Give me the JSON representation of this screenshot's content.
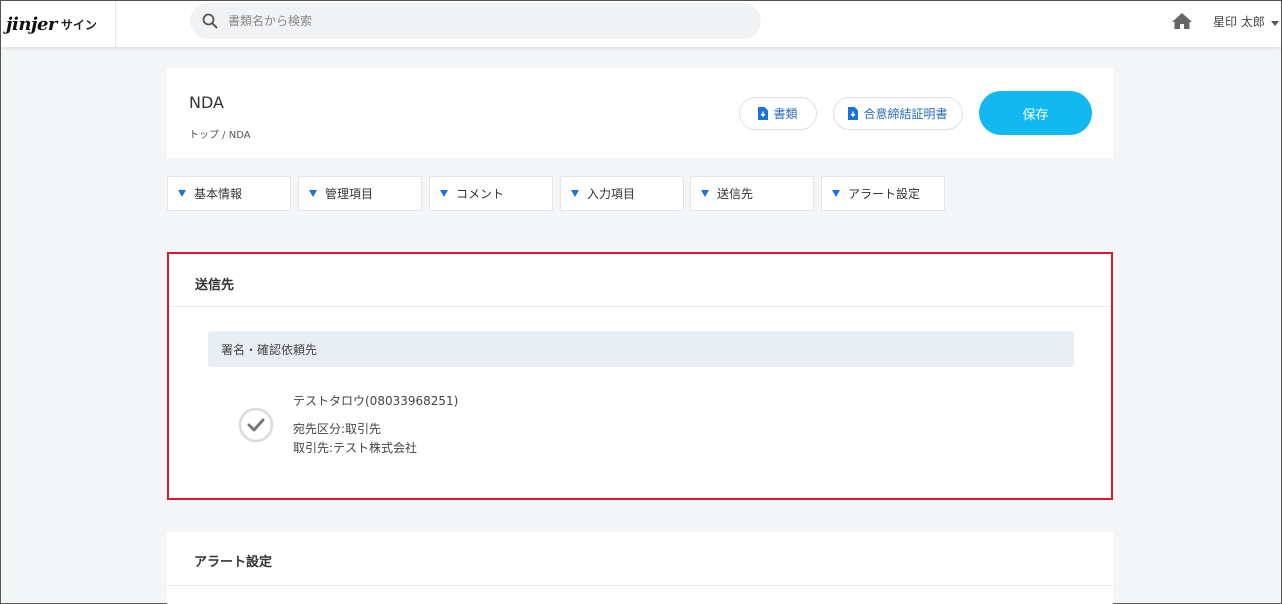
{
  "app": {
    "logo_text": "jinjer",
    "logo_sub": "サイン"
  },
  "search": {
    "placeholder": "書類名から検索"
  },
  "user": {
    "name": "星印 太郎"
  },
  "document": {
    "title": "NDA",
    "breadcrumb": "トップ / NDA"
  },
  "actions": {
    "docs_label": "書類",
    "certificate_label": "合意締結証明書",
    "save_label": "保存"
  },
  "tabs": [
    {
      "label": "基本情報"
    },
    {
      "label": "管理項目"
    },
    {
      "label": "コメント"
    },
    {
      "label": "入力項目"
    },
    {
      "label": "送信先"
    },
    {
      "label": "アラート設定"
    }
  ],
  "destination": {
    "title": "送信先",
    "sub_header": "署名・確認依頼先",
    "recipient": {
      "name": "テストタロウ(08033968251)",
      "type": "宛先区分:取引先",
      "company": "取引先:テスト株式会社"
    }
  },
  "alert": {
    "title": "アラート設定"
  },
  "colors": {
    "accent": "#12b8f0",
    "tab_marker": "#1a73d9",
    "highlight_border": "#e0182c",
    "link": "#2b6cc4"
  }
}
